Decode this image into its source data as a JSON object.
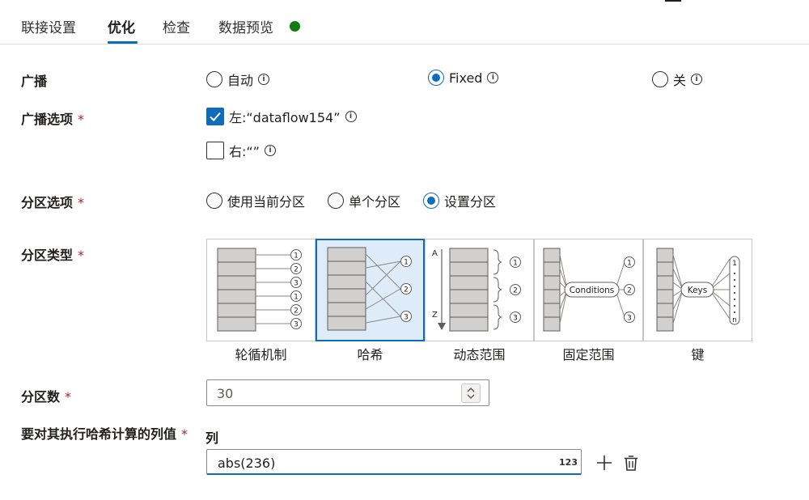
{
  "tabs": [
    {
      "label": "联接设置"
    },
    {
      "label": "优化"
    },
    {
      "label": "检查"
    },
    {
      "label": "数据预览"
    }
  ],
  "colors": {
    "accent": "#0f6cbd",
    "status_dot": "#107c10",
    "required": "#a4262c",
    "selected_tile_bg": "#deecf9"
  },
  "broadcast": {
    "label": "广播",
    "options": [
      {
        "label": "自动",
        "checked": false
      },
      {
        "label": "Fixed",
        "checked": true
      },
      {
        "label": "关",
        "checked": false
      }
    ]
  },
  "broadcast_options": {
    "label": "广播选项",
    "required_mark": "*",
    "left": {
      "label": "左:“dataflow154”",
      "checked": true
    },
    "right": {
      "label": "右:“”",
      "checked": false
    }
  },
  "partition_option": {
    "label": "分区选项",
    "required_mark": "*",
    "options": [
      {
        "label": "使用当前分区",
        "checked": false
      },
      {
        "label": "单个分区",
        "checked": false
      },
      {
        "label": "设置分区",
        "checked": true
      }
    ]
  },
  "partition_type": {
    "label": "分区类型",
    "required_mark": "*",
    "tiles": [
      {
        "label": "轮循机制",
        "selected": false,
        "marks": [
          "1",
          "2",
          "3",
          "1",
          "2",
          "3"
        ]
      },
      {
        "label": "哈希",
        "selected": true,
        "marks": [
          "1",
          "2",
          "3"
        ]
      },
      {
        "label": "动态范围",
        "selected": false,
        "marks": [
          "1",
          "2",
          "3"
        ],
        "axis_top": "A",
        "axis_bottom": "Z"
      },
      {
        "label": "固定范围",
        "selected": false,
        "marks": [
          "1",
          "2",
          "3"
        ],
        "node": "Conditions"
      },
      {
        "label": "键",
        "selected": false,
        "node": "Keys",
        "key_top": "1",
        "key_bottom": "n"
      }
    ]
  },
  "partition_count": {
    "label": "分区数",
    "required_mark": "*",
    "value": "30"
  },
  "hash_columns": {
    "label": "要对其执行哈希计算的列值",
    "required_mark": "*",
    "column_header": "列",
    "expression": "abs(236)",
    "type_badge": "123"
  },
  "icons": [
    "info-icon",
    "checkmark-icon",
    "spinner-icon",
    "add-icon",
    "delete-icon"
  ]
}
